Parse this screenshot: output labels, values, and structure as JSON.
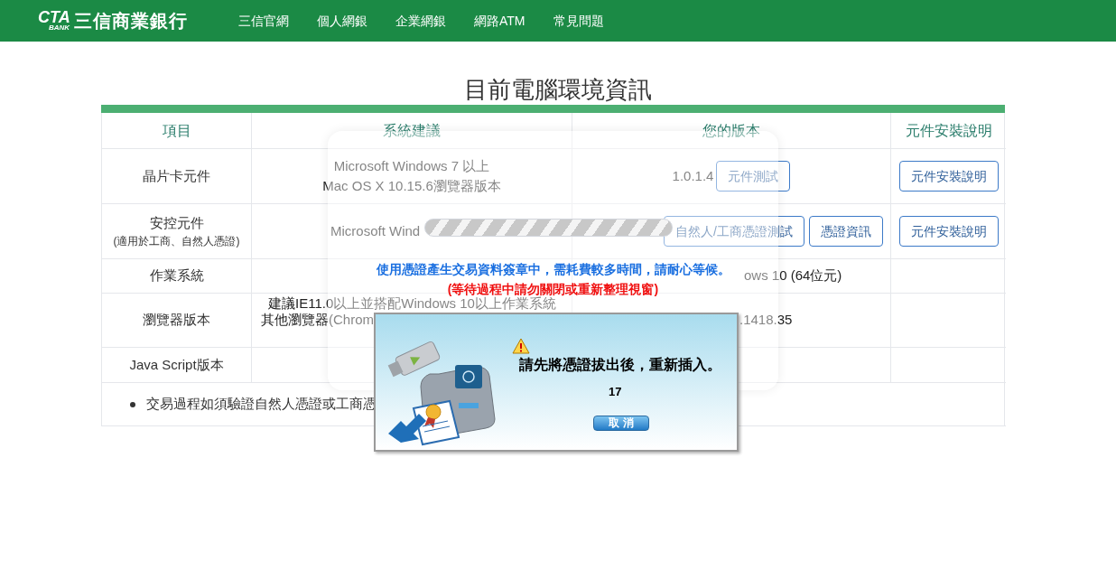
{
  "nav": {
    "logo_mark": "CTA",
    "logo_sub": "BANK",
    "logo_text": "三信商業銀行",
    "items": [
      "三信官網",
      "個人網銀",
      "企業網銀",
      "網路ATM",
      "常見問題"
    ]
  },
  "title": "目前電腦環境資訊",
  "table": {
    "columns": [
      "項目",
      "系統建議",
      "您的版本",
      "元件安裝說明"
    ],
    "rows": [
      {
        "item": "晶片卡元件",
        "recommendation": [
          "Microsoft Windows 7 以上",
          "Mac OS X 10.15.6瀏覽器版本"
        ],
        "version": "1.0.1.4",
        "version_buttons": [
          "元件測試"
        ],
        "help_button": "元件安裝說明"
      },
      {
        "item": "安控元件",
        "item_note": "(適用於工商、自然人憑證)",
        "recommendation": [
          "Microsoft Wind"
        ],
        "version_buttons": [
          "自然人/工商憑證測試",
          "憑證資訊"
        ],
        "help_button": "元件安裝說明"
      },
      {
        "item": "作業系統",
        "version": "ows 10 (64位元)"
      },
      {
        "item": "瀏覽器版本",
        "recommendation": [
          "建議IE11.0以上並搭配Windows 10以上作業系統",
          "其他瀏覽器(Chrom"
        ],
        "version": ".1418.35"
      },
      {
        "item": "Java Script版本"
      }
    ],
    "note": "交易過程如須驗證自然人憑證或工商憑"
  },
  "loading": {
    "message": "使用憑證產生交易資料簽章中，需耗費較多時間，請耐心等候。",
    "warning": "(等待過程中請勿關閉或重新整理視窗)"
  },
  "dialog": {
    "message": "請先將憑證拔出後，重新插入。",
    "countdown": "17",
    "button": "取 消"
  }
}
